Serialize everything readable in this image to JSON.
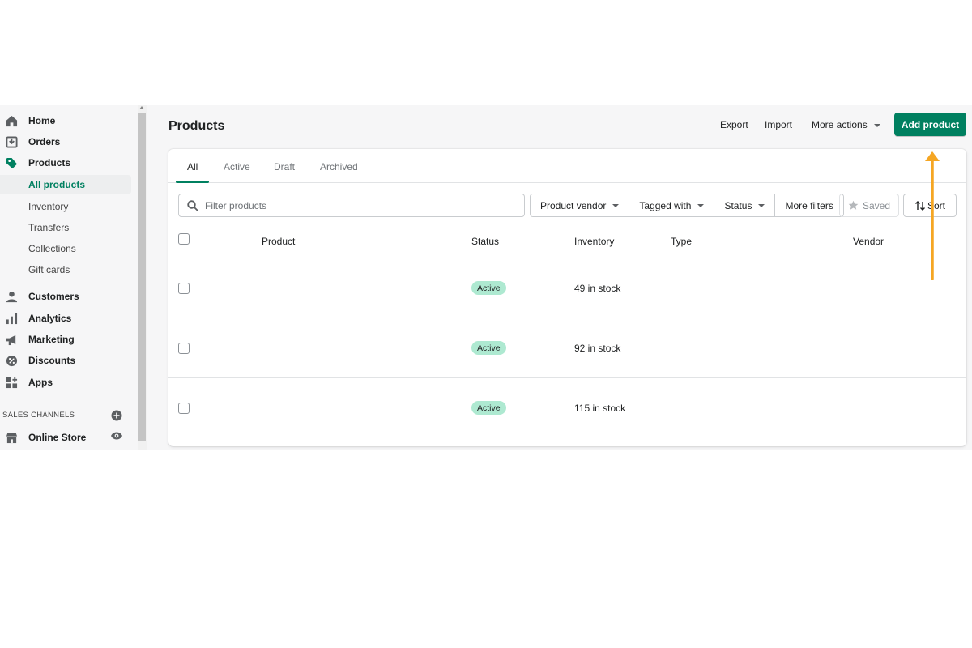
{
  "sidebar": {
    "items": [
      {
        "label": "Home",
        "icon": "home-icon"
      },
      {
        "label": "Orders",
        "icon": "orders-icon"
      },
      {
        "label": "Products",
        "icon": "tag-icon"
      },
      {
        "label": "All products"
      },
      {
        "label": "Inventory"
      },
      {
        "label": "Transfers"
      },
      {
        "label": "Collections"
      },
      {
        "label": "Gift cards"
      },
      {
        "label": "Customers",
        "icon": "person-icon"
      },
      {
        "label": "Analytics",
        "icon": "bar-chart-icon"
      },
      {
        "label": "Marketing",
        "icon": "megaphone-icon"
      },
      {
        "label": "Discounts",
        "icon": "discount-icon"
      },
      {
        "label": "Apps",
        "icon": "apps-icon"
      }
    ],
    "sales_channels_label": "SALES CHANNELS",
    "online_store_label": "Online Store"
  },
  "header": {
    "title": "Products",
    "export_label": "Export",
    "import_label": "Import",
    "more_actions_label": "More actions",
    "add_product_label": "Add product"
  },
  "tabs": [
    "All",
    "Active",
    "Draft",
    "Archived"
  ],
  "filters": {
    "search_placeholder": "Filter products",
    "product_vendor": "Product vendor",
    "tagged_with": "Tagged with",
    "status": "Status",
    "more_filters": "More filters",
    "saved": "Saved",
    "sort": "Sort"
  },
  "table": {
    "headers": [
      "Product",
      "Status",
      "Inventory",
      "Type",
      "Vendor"
    ],
    "rows": [
      {
        "status": "Active",
        "inventory": "49 in stock"
      },
      {
        "status": "Active",
        "inventory": "92 in stock"
      },
      {
        "status": "Active",
        "inventory": "115 in stock"
      }
    ]
  },
  "colors": {
    "accent": "#008060",
    "badge_active": "#aee9d1",
    "annotation_arrow": "#f5a623"
  }
}
